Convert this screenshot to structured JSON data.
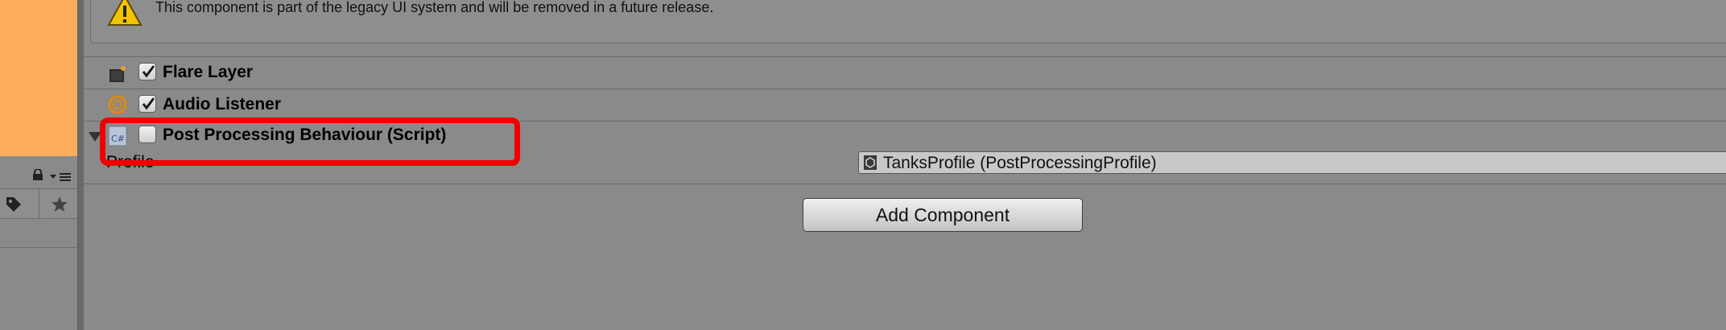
{
  "warning": {
    "text": "This component is part of the legacy UI system and will be removed in a future release."
  },
  "components": [
    {
      "label": "Flare Layer",
      "icon": "flare-layer-icon",
      "checked": true
    },
    {
      "label": "Audio Listener",
      "icon": "audio-listener-icon",
      "checked": true
    },
    {
      "label": "Post Processing Behaviour (Script)",
      "icon": "csharp-script-icon",
      "checked": false
    }
  ],
  "property": {
    "label": "Profile",
    "value": "TanksProfile (PostProcessingProfile)"
  },
  "add_component_label": "Add Component",
  "colors": {
    "scene_preview": "#fdad5a",
    "highlight": "#ee0000",
    "panel_bg": "#8a8a8a"
  }
}
